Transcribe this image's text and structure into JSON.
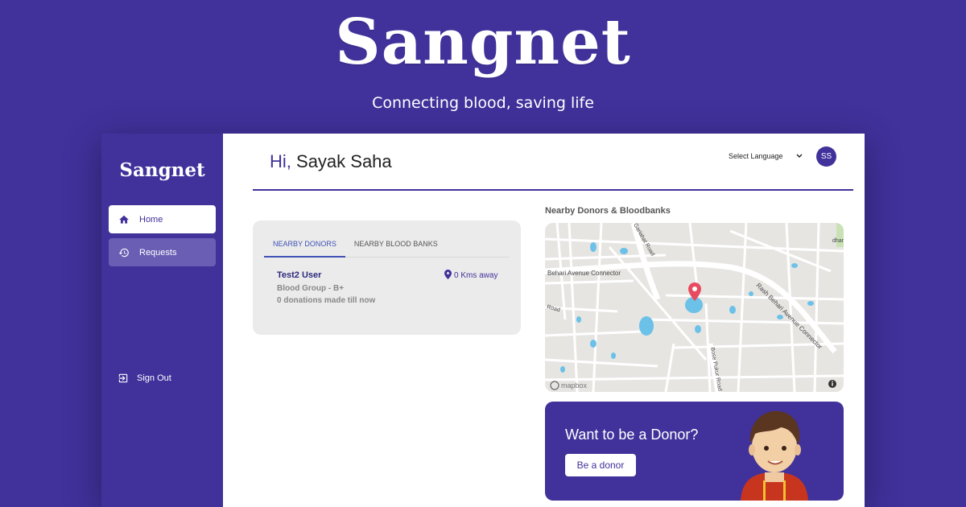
{
  "hero": {
    "title": "Sangnet",
    "subtitle": "Connecting blood, saving life"
  },
  "sidebar": {
    "logo": "Sangnet",
    "items": [
      {
        "label": "Home",
        "icon": "home-icon",
        "active": true
      },
      {
        "label": "Requests",
        "icon": "history-icon",
        "active": false
      }
    ],
    "signout_label": "Sign Out"
  },
  "header": {
    "greeting_prefix": "Hi,",
    "user_name": "Sayak Saha",
    "language_select": "Select Language",
    "avatar_initials": "SS"
  },
  "donors_panel": {
    "tabs": [
      {
        "label": "NEARBY DONORS",
        "active": true
      },
      {
        "label": "NEARBY BLOOD BANKS",
        "active": false
      }
    ],
    "donor": {
      "name": "Test2 User",
      "distance": "0 Kms away",
      "blood_group": "Blood Group - B+",
      "donations": "0 donations made till now"
    }
  },
  "map": {
    "title": "Nearby Donors & Bloodbanks",
    "attribution": "mapbox",
    "street_labels": [
      "Behari Avenue Connector",
      "Rash Behari Avenue Connector",
      "Bose Pukur Road",
      "Gariahat Road",
      "Road",
      "dhan"
    ]
  },
  "cta": {
    "title": "Want to be a Donor?",
    "button_label": "Be a donor"
  },
  "colors": {
    "brand": "#40319b",
    "tab_active": "#3f51b5",
    "map_pin": "#e84a5f",
    "water": "#6cc1e8"
  }
}
